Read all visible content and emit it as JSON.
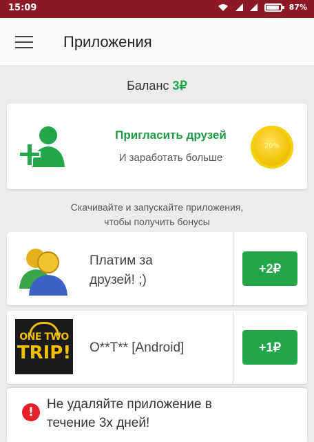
{
  "status_bar": {
    "time": "15:09",
    "battery": "87%"
  },
  "app_bar": {
    "title": "Приложения"
  },
  "balance": {
    "label": "Баланс",
    "amount": "3₽"
  },
  "invite": {
    "title": "Пригласить друзей",
    "subtitle": "И заработать больше",
    "coin_text": "20%"
  },
  "hint": {
    "line1": "Скачивайте и запускайте приложения,",
    "line2": "чтобы получить бонусы"
  },
  "offers": [
    {
      "line1": "Платим за",
      "line2": "друзей! ;)",
      "reward": "+2₽",
      "icon": "friends-icon"
    },
    {
      "line1": "O**T**  [Android]",
      "reward": "+1₽",
      "logo_line1": "ONE TWO",
      "logo_line2": "TRIP!",
      "icon": "onetwotrip-logo"
    }
  ],
  "toast": {
    "line1": "Не удаляйте приложение в",
    "line2": "течение 3х дней!",
    "icon": "alert-icon"
  },
  "colors": {
    "accent": "#22a64a",
    "status_bar": "#8b1a24",
    "alert": "#e5222c",
    "coin": "#f0c000"
  }
}
